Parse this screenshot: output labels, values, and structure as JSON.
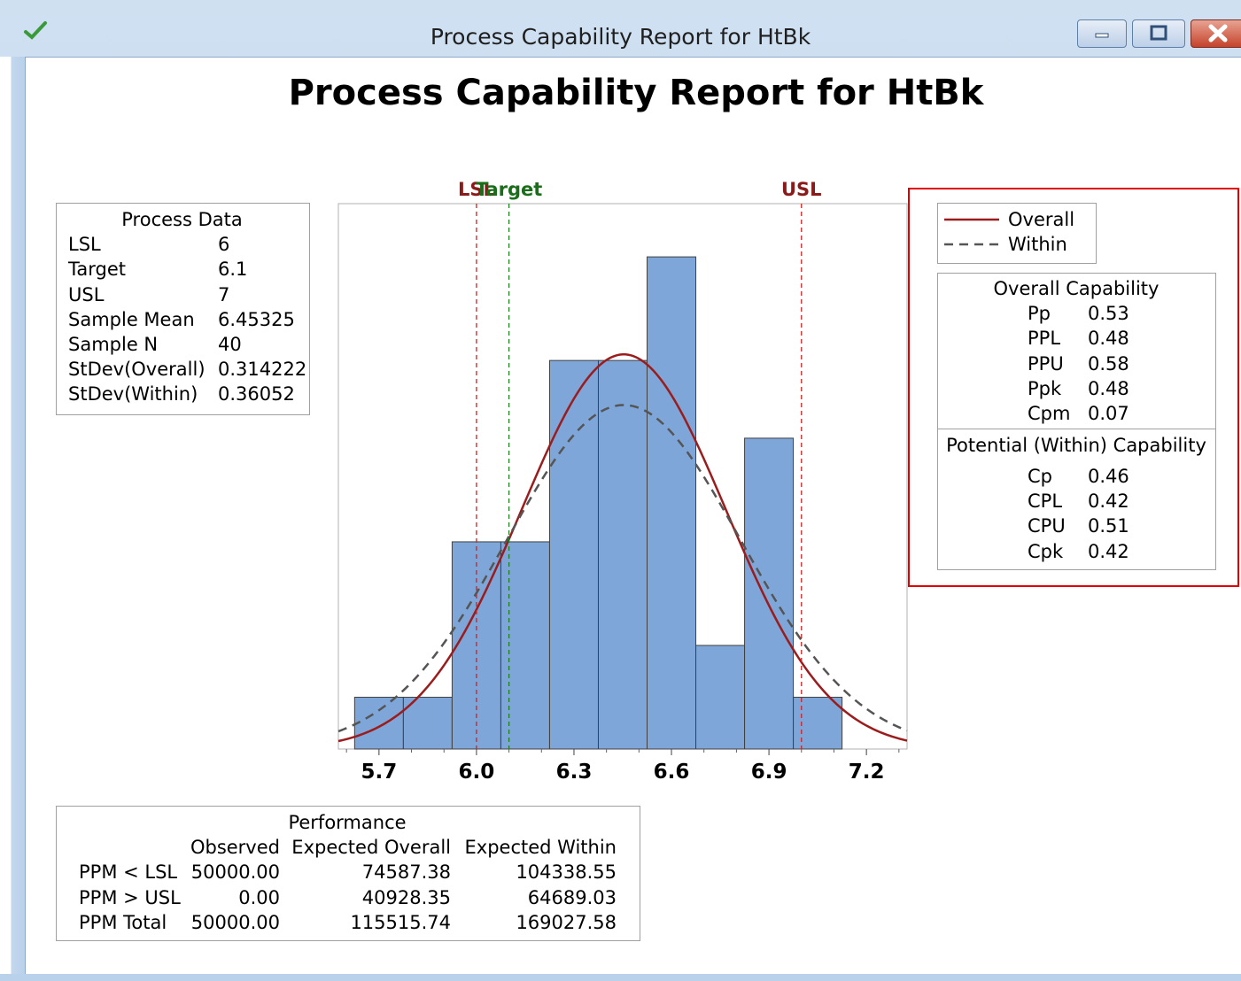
{
  "window": {
    "title": "Process Capability Report for HtBk"
  },
  "report": {
    "title": "Process Capability Report for HtBk"
  },
  "process_data": {
    "heading": "Process Data",
    "rows": [
      {
        "label": "LSL",
        "value": "6"
      },
      {
        "label": "Target",
        "value": "6.1"
      },
      {
        "label": "USL",
        "value": "7"
      },
      {
        "label": "Sample Mean",
        "value": "6.45325"
      },
      {
        "label": "Sample N",
        "value": "40"
      },
      {
        "label": "StDev(Overall)",
        "value": "0.314222"
      },
      {
        "label": "StDev(Within)",
        "value": "0.36052"
      }
    ]
  },
  "legend": {
    "overall": "Overall",
    "within": "Within"
  },
  "overall_capability": {
    "heading": "Overall Capability",
    "rows": [
      {
        "label": "Pp",
        "value": "0.53"
      },
      {
        "label": "PPL",
        "value": "0.48"
      },
      {
        "label": "PPU",
        "value": "0.58"
      },
      {
        "label": "Ppk",
        "value": "0.48"
      },
      {
        "label": "Cpm",
        "value": "0.07"
      }
    ]
  },
  "within_capability": {
    "heading": "Potential (Within) Capability",
    "rows": [
      {
        "label": "Cp",
        "value": "0.46"
      },
      {
        "label": "CPL",
        "value": "0.42"
      },
      {
        "label": "CPU",
        "value": "0.51"
      },
      {
        "label": "Cpk",
        "value": "0.42"
      }
    ]
  },
  "performance": {
    "heading": "Performance",
    "columns": [
      "Observed",
      "Expected Overall",
      "Expected Within"
    ],
    "rows": [
      {
        "label": "PPM < LSL",
        "values": [
          "50000.00",
          "74587.38",
          "104338.55"
        ]
      },
      {
        "label": "PPM > USL",
        "values": [
          "0.00",
          "40928.35",
          "64689.03"
        ]
      },
      {
        "label": "PPM Total",
        "values": [
          "50000.00",
          "115515.74",
          "169027.58"
        ]
      }
    ]
  },
  "colors": {
    "bar_fill": "#7ea6d8",
    "bar_stroke": "#404040",
    "overall_curve": "#9b1c1c",
    "within_curve": "#555555",
    "spec_line": "#d02020",
    "target_line": "#208020",
    "lsl_usl_label": "#8b1a1a",
    "target_label": "#1a6e1a",
    "highlight": "#e00000"
  },
  "chart_data": {
    "type": "bar",
    "subtype": "histogram-with-normal-curves",
    "xlim": [
      5.575,
      7.325
    ],
    "x_ticks": [
      5.7,
      6.0,
      6.3,
      6.6,
      6.9,
      7.2
    ],
    "x_tick_labels": [
      "5.7",
      "6.0",
      "6.3",
      "6.6",
      "6.9",
      "7.2"
    ],
    "bins": [
      {
        "start": 5.625,
        "end": 5.775,
        "count": 1
      },
      {
        "start": 5.775,
        "end": 5.925,
        "count": 1
      },
      {
        "start": 5.925,
        "end": 6.075,
        "count": 4
      },
      {
        "start": 6.075,
        "end": 6.225,
        "count": 4
      },
      {
        "start": 6.225,
        "end": 6.375,
        "count": 7.5
      },
      {
        "start": 6.375,
        "end": 6.525,
        "count": 7.5
      },
      {
        "start": 6.525,
        "end": 6.675,
        "count": 9.5
      },
      {
        "start": 6.675,
        "end": 6.825,
        "count": 2
      },
      {
        "start": 6.825,
        "end": 6.975,
        "count": 6
      },
      {
        "start": 6.975,
        "end": 7.125,
        "count": 1
      }
    ],
    "y_max": 10.1,
    "spec_lines": [
      {
        "name": "LSL",
        "x": 6.0
      },
      {
        "name": "Target",
        "x": 6.1
      },
      {
        "name": "USL",
        "x": 7.0
      }
    ],
    "curves": [
      {
        "name": "Overall",
        "mean": 6.45325,
        "stdev": 0.314222,
        "style": "solid"
      },
      {
        "name": "Within",
        "mean": 6.45325,
        "stdev": 0.36052,
        "style": "dashed"
      }
    ],
    "sample_n": 40
  }
}
